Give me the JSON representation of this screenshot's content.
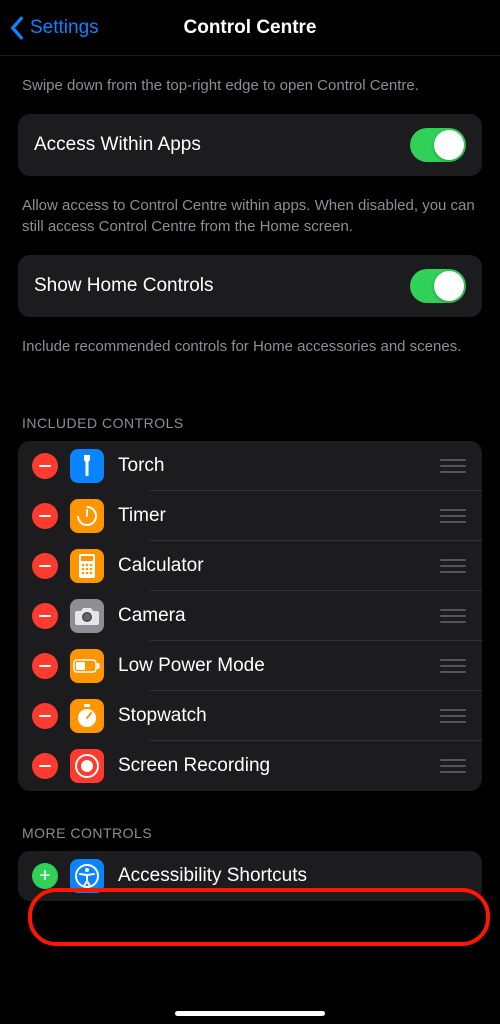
{
  "nav": {
    "back": "Settings",
    "title": "Control Centre"
  },
  "intro": "Swipe down from the top-right edge to open Control Centre.",
  "access": {
    "label": "Access Within Apps",
    "desc": "Allow access to Control Centre within apps. When disabled, you can still access Control Centre from the Home screen."
  },
  "home": {
    "label": "Show Home Controls",
    "desc": "Include recommended controls for Home accessories and scenes."
  },
  "included": {
    "header": "INCLUDED CONTROLS",
    "items": [
      {
        "label": "Torch"
      },
      {
        "label": "Timer"
      },
      {
        "label": "Calculator"
      },
      {
        "label": "Camera"
      },
      {
        "label": "Low Power Mode"
      },
      {
        "label": "Stopwatch"
      },
      {
        "label": "Screen Recording"
      }
    ]
  },
  "more": {
    "header": "MORE CONTROLS",
    "items": [
      {
        "label": "Accessibility Shortcuts"
      }
    ]
  }
}
